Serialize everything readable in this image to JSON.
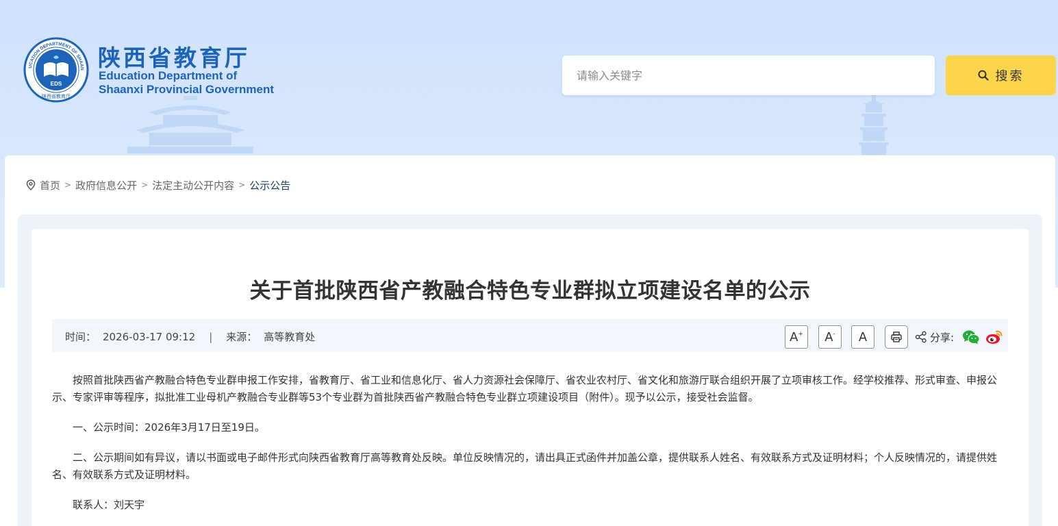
{
  "site": {
    "name_cn": "陕西省教育厅",
    "name_en_line1": "Education Department of",
    "name_en_line2": "Shaanxi Provincial Government",
    "emblem_ring_text": "EDUCATION DEPARTMENT OF SHAANXI",
    "emblem_badge": "EDS",
    "emblem_bottom_text": "陕西省教育厅"
  },
  "search": {
    "placeholder": "请输入关键字",
    "button_label": "搜索"
  },
  "breadcrumb": {
    "items": [
      "首页",
      "政府信息公开",
      "法定主动公开内容",
      "公示公告"
    ],
    "separator": ">"
  },
  "article": {
    "title": "关于首批陕西省产教融合特色专业群拟立项建设名单的公示",
    "time_label": "时间：",
    "time_value": "2026-03-17 09:12",
    "meta_divider": "|",
    "source_label": "来源：",
    "source_value": "高等教育处",
    "paragraphs": [
      "按照首批陕西省产教融合特色专业群申报工作安排，省教育厅、省工业和信息化厅、省人力资源社会保障厅、省农业农村厅、省文化和旅游厅联合组织开展了立项审核工作。经学校推荐、形式审查、申报公示、专家评审等程序，拟批准工业母机产教融合专业群等53个专业群为首批陕西省产教融合特色专业群立项建设项目（附件）。现予以公示，接受社会监督。",
      "一、公示时间：2026年3月17日至19日。",
      "二、公示期间如有异议，请以书面或电子邮件形式向陕西省教育厅高等教育处反映。单位反映情况的，请出具正式函件并加盖公章，提供联系人姓名、有效联系方式及证明材料；个人反映情况的，请提供姓名、有效联系方式及证明材料。",
      "联系人：刘天宇"
    ]
  },
  "tools": {
    "font_large": "A",
    "font_large_sup": "+",
    "font_small": "A",
    "font_small_sup": "-",
    "font_default": "A",
    "share_label": "分享:"
  },
  "colors": {
    "brand_blue": "#1d63b7",
    "search_button": "#fcd54d",
    "wechat_green": "#22ac38",
    "weibo_red": "#e6162d"
  },
  "icons": [
    "location-pin-icon",
    "search-icon",
    "print-icon",
    "share-icon",
    "wechat-icon",
    "weibo-icon"
  ]
}
